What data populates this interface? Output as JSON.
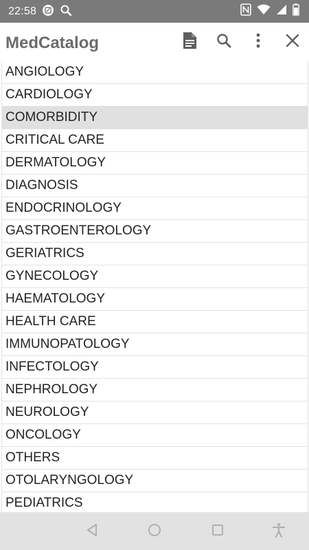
{
  "status_bar": {
    "time": "22:58",
    "icons": [
      "notification-app-icon",
      "search-icon",
      "nfc-icon",
      "wifi-icon",
      "cellular-icon",
      "battery-icon"
    ]
  },
  "app_bar": {
    "title": "MedCatalog",
    "actions": [
      "document-icon",
      "search-icon",
      "more-vert-icon",
      "close-icon"
    ]
  },
  "list": {
    "selected_index": 2,
    "items": [
      "ANGIOLOGY",
      "CARDIOLOGY",
      "COMORBIDITY",
      "CRITICAL CARE",
      "DERMATOLOGY",
      "DIAGNOSIS",
      "ENDOCRINOLOGY",
      "GASTROENTEROLOGY",
      "GERIATRICS",
      "GYNECOLOGY",
      "HAEMATOLOGY",
      "HEALTH CARE",
      "IMMUNOPATOLOGY",
      "INFECTOLOGY",
      "NEPHROLOGY",
      "NEUROLOGY",
      "ONCOLOGY",
      "OTHERS",
      "OTOLARYNGOLOGY",
      "PEDIATRICS"
    ]
  },
  "nav_bar": {
    "buttons": [
      "back-icon",
      "home-icon",
      "recents-icon",
      "accessibility-icon"
    ]
  },
  "colors": {
    "status_bar": "#7a7a7a",
    "title": "#6b6b6b",
    "selected_row": "#e0e0e0",
    "nav_bar": "#e2e2e2",
    "divider": "#e2e2e2"
  }
}
